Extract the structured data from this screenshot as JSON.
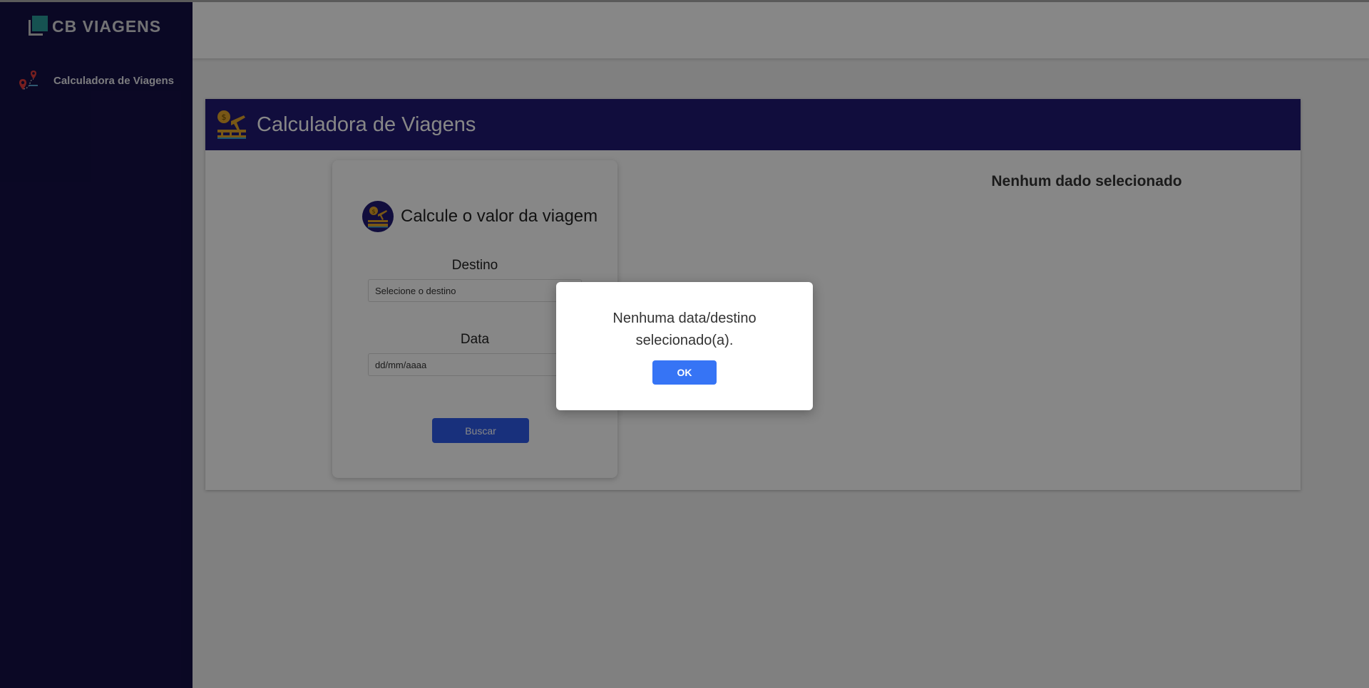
{
  "app": {
    "brand": "CB VIAGENS"
  },
  "sidebar": {
    "items": [
      {
        "label": "Calculadora de Viagens",
        "icon": "map-pins-icon"
      }
    ]
  },
  "panel": {
    "title": "Calculadora de Viagens",
    "icon": "travel-cost-icon"
  },
  "form": {
    "title": "Calcule o valor da viagem",
    "destination_label": "Destino",
    "destination_value": "Selecione o destino",
    "date_label": "Data",
    "date_placeholder": "dd/mm/aaaa",
    "search_label": "Buscar"
  },
  "results": {
    "empty_message": "Nenhum dado selecionado"
  },
  "dialog": {
    "message": "Nenhuma data/destino selecionado(a).",
    "ok_label": "OK"
  },
  "colors": {
    "sidebar_bg": "#141045",
    "panel_header_bg": "#211a73",
    "primary_button": "#2f5bea",
    "dialog_button": "#3674f5",
    "logo_accent": "#2b9c9a"
  }
}
